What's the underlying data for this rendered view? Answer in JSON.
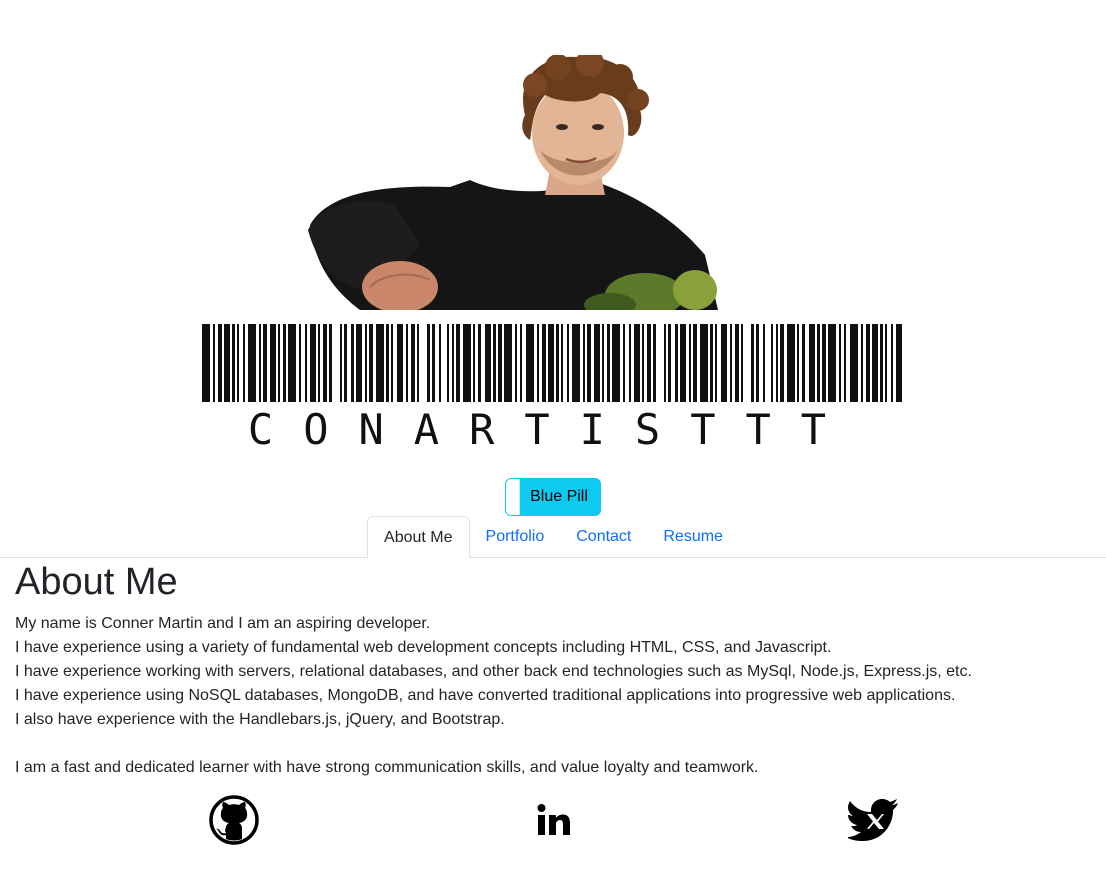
{
  "header": {
    "photo_alt": "Conner Martin portrait",
    "barcode_text": "CONARTISTTT"
  },
  "theme_toggle": {
    "label": "Blue Pill",
    "color": "#0dcaf0"
  },
  "nav": {
    "tabs": [
      {
        "label": "About Me",
        "active": true
      },
      {
        "label": "Portfolio",
        "active": false
      },
      {
        "label": "Contact",
        "active": false
      },
      {
        "label": "Resume",
        "active": false
      }
    ],
    "link_color": "#0d6efd"
  },
  "about": {
    "title": "About Me",
    "lines": [
      "My name is Conner Martin and I am an aspiring developer.",
      "I have experience using a variety of fundamental web development concepts including HTML, CSS, and Javascript.",
      "I have experience working with servers, relational databases, and other back end technologies such as MySql, Node.js, Express.js, etc.",
      "I have experience using NoSQL databases, MongoDB, and have converted traditional applications into progressive web applications.",
      "I also have experience with the Handlebars.js, jQuery, and Bootstrap."
    ],
    "closing": "I am a fast and dedicated learner with have strong communication skills, and value loyalty and teamwork."
  },
  "socials": [
    {
      "name": "github",
      "icon": "github-icon"
    },
    {
      "name": "linkedin",
      "icon": "linkedin-icon"
    },
    {
      "name": "twitter",
      "icon": "twitter-x-icon"
    }
  ]
}
